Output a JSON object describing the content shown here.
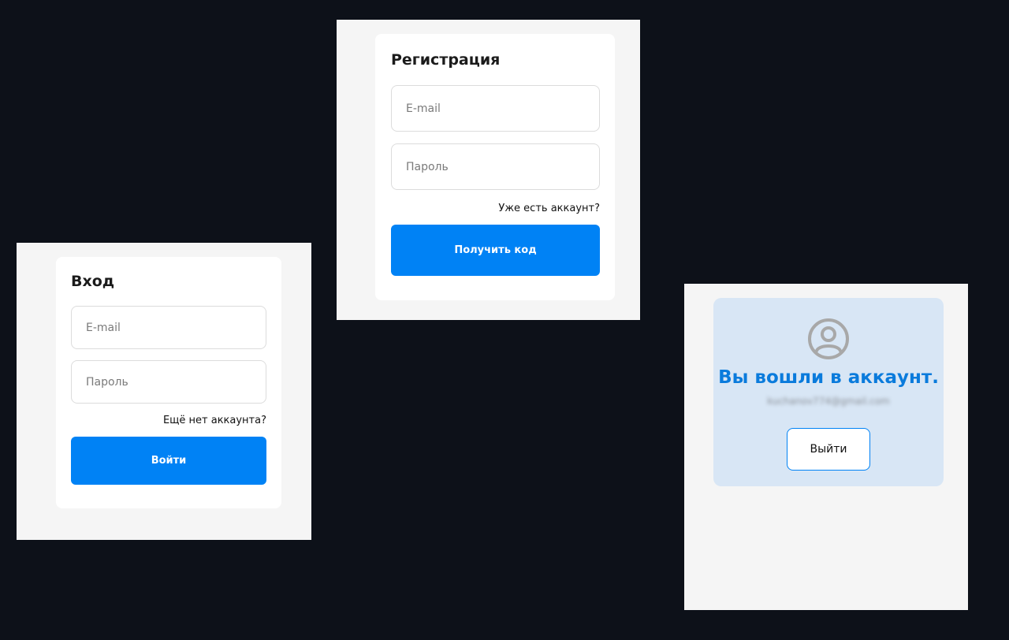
{
  "login": {
    "title": "Вход",
    "email_placeholder": "E-mail",
    "password_placeholder": "Пароль",
    "switch_link": "Ещё нет аккаунта?",
    "submit_label": "Войти"
  },
  "register": {
    "title": "Регистрация",
    "email_placeholder": "E-mail",
    "password_placeholder": "Пароль",
    "switch_link": "Уже есть аккаунт?",
    "submit_label": "Получить код"
  },
  "account": {
    "title": "Вы вошли в аккаунт.",
    "email": "kuchanov774@gmail.com",
    "logout_label": "Выйти",
    "avatar_icon": "user-circle-icon"
  },
  "colors": {
    "page_background": "#0d1119",
    "panel_background": "#f5f5f5",
    "accent": "#0082f5",
    "success_box": "#d8e6f5",
    "avatar_gray": "#a8a8a8"
  }
}
